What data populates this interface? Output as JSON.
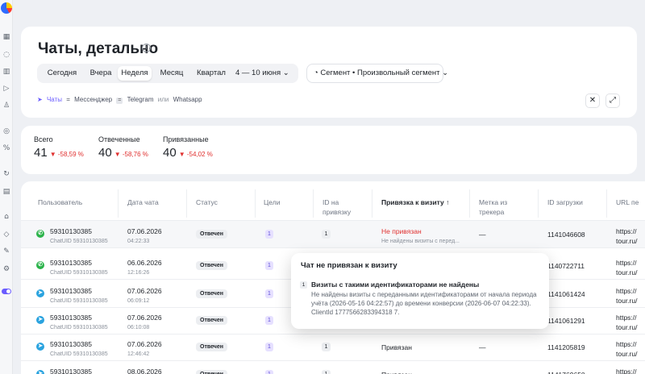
{
  "rail": {
    "icons": [
      "grid-icon",
      "globe-icon",
      "chart-icon",
      "play-icon",
      "user-icon",
      "target-icon",
      "percent-icon",
      "refresh-icon",
      "calendar-icon",
      "home-icon",
      "tag-icon",
      "edit-icon",
      "settings-icon"
    ]
  },
  "header": {
    "title": "Чаты, детально",
    "periods": [
      "Сегодня",
      "Вчера",
      "Неделя",
      "Месяц",
      "Квартал",
      "4 — 10 июня"
    ],
    "segment": "Сегмент • Произвольный сегмент",
    "filters": {
      "icon": "paper-plane-icon",
      "label": "Чаты",
      "eq": "=",
      "messenger": "Мессенджер",
      "is": "=",
      "tg": "Telegram",
      "or": "или",
      "wa": "Whatsapp"
    },
    "actions": {
      "close": "✕",
      "expand": "⤢"
    }
  },
  "stats": [
    {
      "label": "Всего",
      "value": "41",
      "delta": "▼ -58,59 %"
    },
    {
      "label": "Отвеченные",
      "value": "40",
      "delta": "▼ -58,76 %"
    },
    {
      "label": "Привязанные",
      "value": "40",
      "delta": "▼ -54,02 %"
    }
  ],
  "table": {
    "columns": [
      "Пользователь",
      "Дата чата",
      "Статус",
      "Цели",
      "ID на привязку",
      "Привязка к визиту ↑",
      "Метка из трекера",
      "ID загрузки",
      "URL пе"
    ],
    "rows": [
      {
        "messenger": "whatsapp",
        "user": "59310130385",
        "uid": "ChatUID 59310130385",
        "date": "07.06.2026",
        "time": "04:22:33",
        "status": "Отвечен",
        "goals": "1",
        "idb": "1",
        "binding": "Не привязан",
        "binding_sub": "Не найдены визиты с перед...",
        "mark": "—",
        "load": "1141046608",
        "url": "https://",
        "url2": "tour.ru/"
      },
      {
        "messenger": "whatsapp",
        "user": "59310130385",
        "uid": "ChatUID 59310130385",
        "date": "06.06.2026",
        "time": "12:16:26",
        "status": "Отвечен",
        "goals": "1",
        "idb": "",
        "binding": "",
        "binding_sub": "",
        "mark": "",
        "load": "1140722711",
        "url": "https://",
        "url2": "tour.ru/"
      },
      {
        "messenger": "telegram",
        "user": "59310130385",
        "uid": "ChatUID 59310130385",
        "date": "07.06.2026",
        "time": "06:09:12",
        "status": "Отвечен",
        "goals": "1",
        "idb": "",
        "binding": "",
        "binding_sub": "",
        "mark": "",
        "load": "1141061424",
        "url": "https://",
        "url2": "tour.ru/"
      },
      {
        "messenger": "telegram",
        "user": "59310130385",
        "uid": "ChatUID 59310130385",
        "date": "07.06.2026",
        "time": "06:10:08",
        "status": "Отвечен",
        "goals": "1",
        "idb": "",
        "binding": "",
        "binding_sub": "",
        "mark": "",
        "load": "1141061291",
        "url": "https://",
        "url2": "tour.ru/"
      },
      {
        "messenger": "telegram",
        "user": "59310130385",
        "uid": "ChatUID 59310130385",
        "date": "07.06.2026",
        "time": "12:46:42",
        "status": "Отвечен",
        "goals": "1",
        "idb": "1",
        "binding": "Привязан",
        "binding_sub": "",
        "mark": "—",
        "load": "1141205819",
        "url": "https://",
        "url2": "tour.ru/"
      },
      {
        "messenger": "telegram",
        "user": "59310130385",
        "uid": "",
        "date": "08.06.2026",
        "time": "",
        "status": "Отвечен",
        "goals": "1",
        "idb": "1",
        "binding": "Привязан",
        "binding_sub": "",
        "mark": "—",
        "load": "1141769650",
        "url": "https://",
        "url2": ""
      }
    ]
  },
  "tooltip": {
    "title": "Чат не привязан к визиту",
    "num": "1",
    "heading": "Визиты с такими идентификаторами не найдены",
    "text": "Не найдены визиты с переданными идентификаторами от начала периода учёта (2026-05-16 04:22:57) до времени конверсии (2026-06-07 04:22:33). ClientId 1777566283394318 7."
  },
  "colors": {
    "accent": "#6a5cff",
    "negative": "#e0302f",
    "whatsapp": "#2bb34a",
    "telegram": "#2aa3df"
  }
}
